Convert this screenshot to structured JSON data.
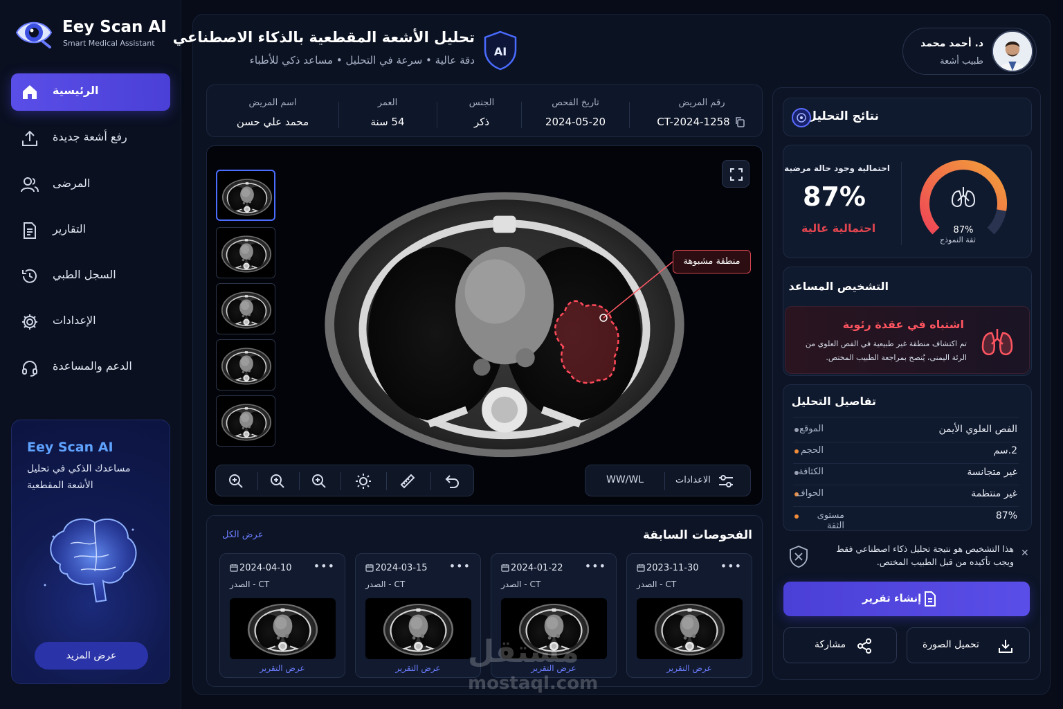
{
  "app": {
    "name": "Eey Scan AI",
    "tagline": "Smart Medical Assistant"
  },
  "sidebar": {
    "items": [
      {
        "label": "الرئيسية",
        "icon": "home-icon",
        "active": true
      },
      {
        "label": "رفع أشعة جديدة",
        "icon": "upload-icon"
      },
      {
        "label": "المرضى",
        "icon": "users-icon"
      },
      {
        "label": "التقارير",
        "icon": "document-icon"
      },
      {
        "label": "السجل الطبي",
        "icon": "history-icon"
      },
      {
        "label": "الإعدادات",
        "icon": "gear-icon"
      },
      {
        "label": "الدعم والمساعدة",
        "icon": "headset-icon"
      }
    ],
    "promo": {
      "title": "Eey Scan AI",
      "text": "مساعدك الذكي في تحليل الأشعة المقطعية",
      "button": "عرض المزيد"
    }
  },
  "header": {
    "title": "تحليل الأشعة المقطعية بالذكاء الاصطناعي",
    "subtitle": "دقة عالية • سرعة في التحليل • مساعد ذكي للأطباء",
    "ai_badge": "AI"
  },
  "doctor": {
    "name": "د. أحمد محمد",
    "role": "طبيب أشعة"
  },
  "patient": {
    "id_label": "رقم المريض",
    "id": "CT-2024-1258",
    "date_label": "تاريخ الفحص",
    "date": "2024-05-20",
    "gender_label": "الجنس",
    "gender": "ذكر",
    "age_label": "العمر",
    "age": "54 سنة",
    "name_label": "اسم المريض",
    "name": "محمد علي حسن"
  },
  "viewer": {
    "suspect_label": "منطقة مشبوهة",
    "window_level": "WW/WL",
    "settings_label": "الاعدادات"
  },
  "previous_exams": {
    "title": "الفحوصات السابقة",
    "view_all": "عرض الكل",
    "exams": [
      {
        "date": "2024-04-10",
        "type": "CT - الصدر",
        "link": "عرض التقرير"
      },
      {
        "date": "2024-03-15",
        "type": "CT - الصدر",
        "link": "عرض التقرير"
      },
      {
        "date": "2024-01-22",
        "type": "CT - الصدر",
        "link": "عرض التقرير"
      },
      {
        "date": "2023-11-30",
        "type": "CT - الصدر",
        "link": "عرض التقرير"
      }
    ]
  },
  "results": {
    "title": "نتائج التحليل",
    "probability_label": "احتمالية وجود حالة مرضية",
    "probability": "87%",
    "probability_level": "احتمالية عالية",
    "confidence_value": 87,
    "confidence_text": "87%",
    "confidence_label": "ثقة النموذج",
    "diagnosis_title": "التشخيص المساعد",
    "diagnosis_heading": "اشتباه في عقدة رئوية",
    "diagnosis_text": "تم اكتشاف منطقة غير طبيعية في الفص العلوي من الرئة اليمنى، يُنصح بمراجعة الطبيب المختص.",
    "details_title": "تفاصيل التحليل",
    "details": [
      {
        "label": "الموقع",
        "value": "الفص العلوي الأيمن",
        "dot": "#9aa3b5"
      },
      {
        "label": "الحجم",
        "value": "2.سم",
        "dot": "#f08c3a"
      },
      {
        "label": "الكثافة",
        "value": "غير متجانسة",
        "dot": "#9aa3b5"
      },
      {
        "label": "الحواف",
        "value": "غير منتظمة",
        "dot": "#f08c3a"
      },
      {
        "label": "مستوى الثقة",
        "value": "87%",
        "dot": "#f08c3a"
      }
    ],
    "disclaimer": "هذا التشخيص هو نتيجة تحليل ذكاء اصطناعي فقط ويجب تأكيده من قبل الطبيب المختص.",
    "create_report": "إنشاء تقرير",
    "download": "تحميل الصورة",
    "share": "مشاركة"
  },
  "watermark": {
    "arabic": "مستقل",
    "site": "mostaql.com"
  },
  "colors": {
    "accent": "#5a4ee8",
    "danger": "#e0454f",
    "warning": "#f08c3a",
    "link": "#6c7dff"
  }
}
